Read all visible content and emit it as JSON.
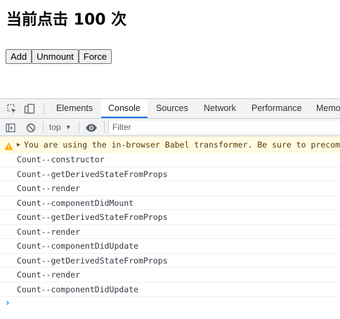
{
  "page": {
    "heading": "当前点击 100 次",
    "buttons": [
      "Add",
      "Unmount",
      "Force"
    ]
  },
  "devtools": {
    "tabs": [
      "Elements",
      "Console",
      "Sources",
      "Network",
      "Performance",
      "Memo"
    ],
    "active_tab": "Console",
    "toolbar": {
      "context": "top",
      "filter_placeholder": "Filter"
    },
    "console": {
      "warning": "You are using the in-browser Babel transformer. Be sure to precompile your scripts for production",
      "logs": [
        "Count--constructor",
        "Count--getDerivedStateFromProps",
        "Count--render",
        "Count--componentDidMount",
        "Count--getDerivedStateFromProps",
        "Count--render",
        "Count--componentDidUpdate",
        "Count--getDerivedStateFromProps",
        "Count--render",
        "Count--componentDidUpdate"
      ],
      "prompt": "›"
    },
    "colors": {
      "accent": "#1a73e8",
      "warning_bg": "#fffbe5",
      "warning_text": "#5c3c00",
      "toolbar_bg": "#f1f3f4"
    }
  }
}
